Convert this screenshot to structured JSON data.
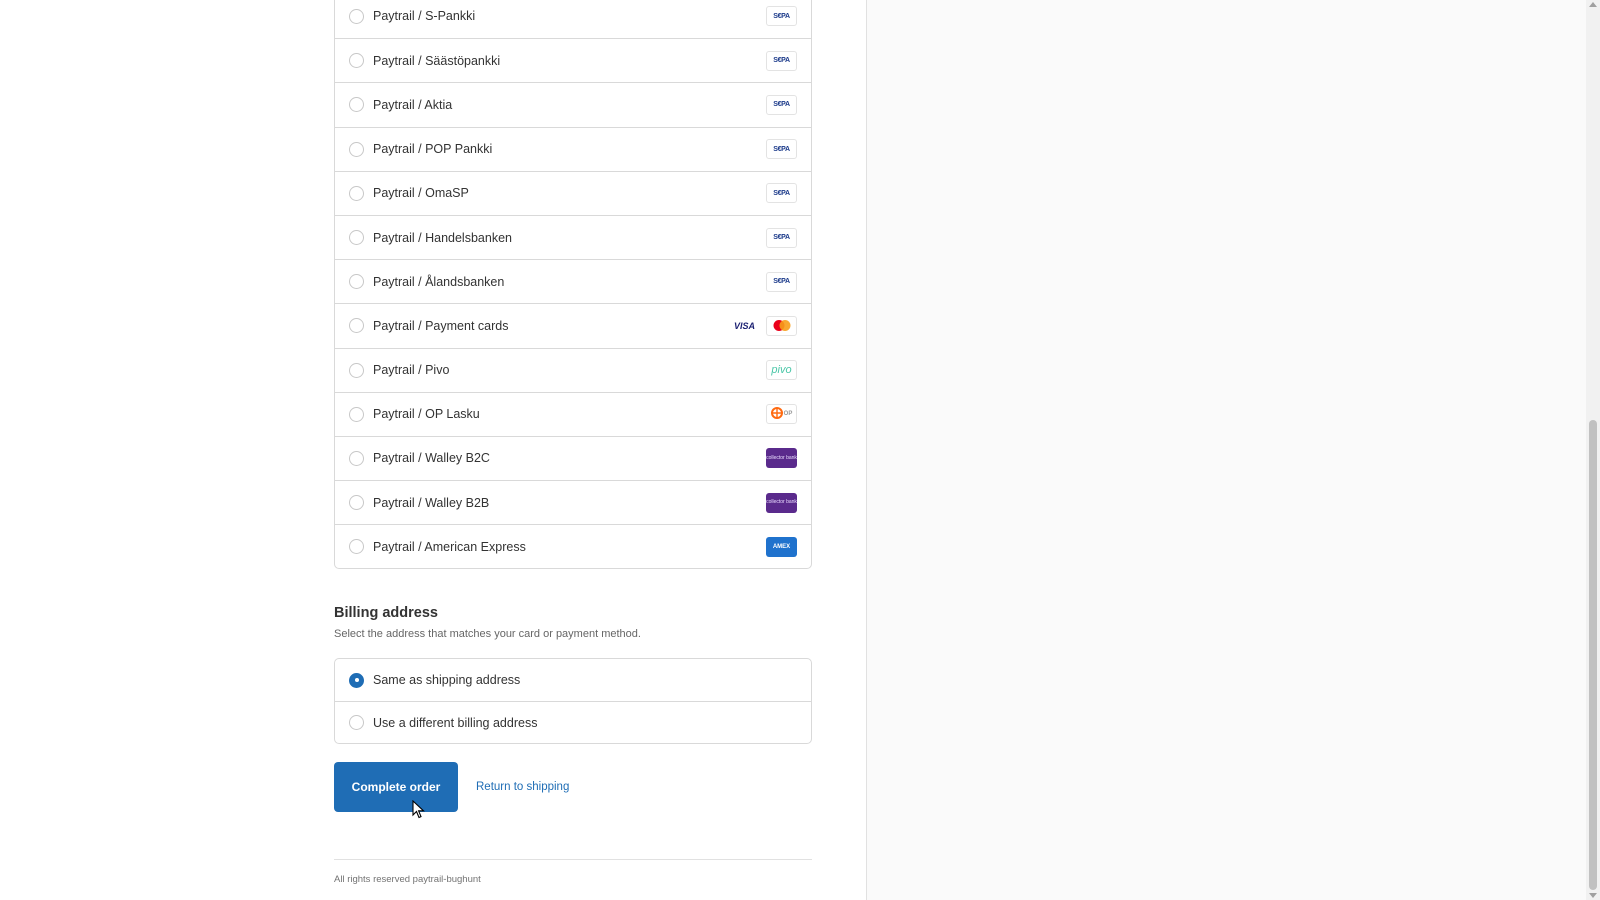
{
  "payment_methods": [
    {
      "label": "Paytrail / S-Pankki",
      "logos": [
        {
          "type": "sepa",
          "text": "S€PA"
        }
      ]
    },
    {
      "label": "Paytrail / Säästöpankki",
      "logos": [
        {
          "type": "sepa",
          "text": "S€PA"
        }
      ]
    },
    {
      "label": "Paytrail / Aktia",
      "logos": [
        {
          "type": "sepa",
          "text": "S€PA"
        }
      ]
    },
    {
      "label": "Paytrail / POP Pankki",
      "logos": [
        {
          "type": "sepa",
          "text": "S€PA"
        }
      ]
    },
    {
      "label": "Paytrail / OmaSP",
      "logos": [
        {
          "type": "sepa",
          "text": "S€PA"
        }
      ]
    },
    {
      "label": "Paytrail / Handelsbanken",
      "logos": [
        {
          "type": "sepa",
          "text": "S€PA"
        }
      ]
    },
    {
      "label": "Paytrail / Ålandsbanken",
      "logos": [
        {
          "type": "sepa",
          "text": "S€PA"
        }
      ]
    },
    {
      "label": "Paytrail / Payment cards",
      "logos": [
        {
          "type": "visa",
          "text": "VISA"
        },
        {
          "type": "mc",
          "text": ""
        }
      ]
    },
    {
      "label": "Paytrail / Pivo",
      "logos": [
        {
          "type": "pivo",
          "text": "pivo"
        }
      ]
    },
    {
      "label": "Paytrail / OP Lasku",
      "logos": [
        {
          "type": "op",
          "text": "OP"
        }
      ]
    },
    {
      "label": "Paytrail / Walley B2C",
      "logos": [
        {
          "type": "walley",
          "text": "collector bank"
        }
      ]
    },
    {
      "label": "Paytrail / Walley B2B",
      "logos": [
        {
          "type": "walley",
          "text": "collector bank"
        }
      ]
    },
    {
      "label": "Paytrail / American Express",
      "logos": [
        {
          "type": "amex",
          "text": "AMEX"
        }
      ]
    }
  ],
  "billing": {
    "title": "Billing address",
    "subtitle": "Select the address that matches your card or payment method.",
    "options": [
      {
        "label": "Same as shipping address",
        "selected": true
      },
      {
        "label": "Use a different billing address",
        "selected": false
      }
    ]
  },
  "actions": {
    "complete_label": "Complete order",
    "return_label": "Return to shipping"
  },
  "footer": {
    "text": "All rights reserved paytrail-bughunt"
  },
  "colors": {
    "accent": "#1f6db5",
    "walley": "#5a2a8c",
    "amex": "#1f72cd"
  }
}
